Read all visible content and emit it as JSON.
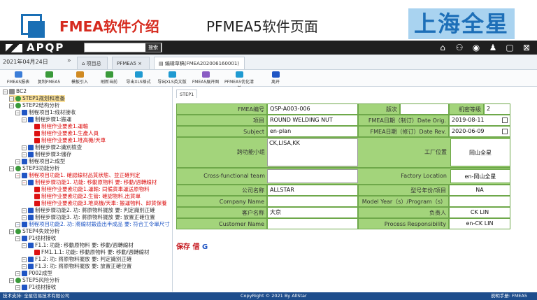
{
  "slide": {
    "title_red": "FMEA软件介绍",
    "title_black": "PFMEA5软件页面",
    "brand": "上海全星"
  },
  "navbar": {
    "app_name": "APQP",
    "search_button": "搜索"
  },
  "tabbar": {
    "date": "2021年04月24日",
    "tabs": [
      "项目总览",
      "PFMEA5",
      "编辑草稿(FMEA202006160001)"
    ]
  },
  "toolbar": {
    "items": [
      "FMEAS报表",
      "复制FMEA5",
      "模板引入",
      "刷新当前",
      "导出XLS格式",
      "导出XLS英文版",
      "FMEA5展开图",
      "PFMEA5优化清单",
      "离开"
    ]
  },
  "tree": {
    "nodes": [
      {
        "text": "BC2",
        "level": 0,
        "style": ""
      },
      {
        "text": "STEP1规划和准备",
        "level": 1,
        "style": "sel"
      },
      {
        "text": "STEP2结构分析",
        "level": 1,
        "style": ""
      },
      {
        "text": "制程项目1:线材接收",
        "level": 2,
        "style": ""
      },
      {
        "text": "制程步骤1:搬運",
        "level": 3,
        "style": ""
      },
      {
        "text": "制程作业要素1.運輸",
        "level": 4,
        "style": "red"
      },
      {
        "text": "制程作业要素1.生產人員",
        "level": 4,
        "style": "red"
      },
      {
        "text": "制程作业要素1.堆高機/天車",
        "level": 4,
        "style": "red"
      },
      {
        "text": "制程步骤2:識別檢查",
        "level": 3,
        "style": ""
      },
      {
        "text": "制程步骤3:儲存",
        "level": 3,
        "style": ""
      },
      {
        "text": "制程项目2:成型",
        "level": 2,
        "style": ""
      },
      {
        "text": "STEP3功能分析",
        "level": 1,
        "style": ""
      },
      {
        "text": "制程项目功能1. 確認線材品質狀態、並正確判定",
        "level": 2,
        "style": "red"
      },
      {
        "text": "制程步骤功能1. 功能: 移動原物料 要: 移動/週轉線材",
        "level": 3,
        "style": "red"
      },
      {
        "text": "制程作业要素功能1.運輸: 同備貨車運送原物料",
        "level": 4,
        "style": "red"
      },
      {
        "text": "制程作业要素功能2.生管: 確認物料,出貨單",
        "level": 4,
        "style": "red"
      },
      {
        "text": "制程作业要素功能3.堆高機/天車: 搬運物料、卸貨保養",
        "level": 4,
        "style": "red"
      },
      {
        "text": "制程步骤功能2. 功: 將原物料擺放 要: 判定識別正確",
        "level": 3,
        "style": ""
      },
      {
        "text": "制程步骤功能3. 功: 將原物料擺放 要: 放置正確位置",
        "level": 3,
        "style": ""
      },
      {
        "text": "制程项目功能2. 功: 將線材鍛造出半成品 要: 符合工令單尺寸",
        "level": 2,
        "style": "blue"
      },
      {
        "text": "STEP4失效分析",
        "level": 1,
        "style": ""
      },
      {
        "text": "P1线材接收",
        "level": 2,
        "style": ""
      },
      {
        "text": "F1.1: 功能: 移動原物料 要: 移動/週轉線材",
        "level": 3,
        "style": ""
      },
      {
        "text": "FM1.1.1: 功能: 移動原物料 要: 移動/週轉線材",
        "level": 4,
        "style": ""
      },
      {
        "text": "F1.2: 功: 將原物料擺放 要: 判定識別正確",
        "level": 3,
        "style": ""
      },
      {
        "text": "F1.3: 功: 將原物料擺放 要: 放置正確位置",
        "level": 3,
        "style": ""
      },
      {
        "text": "P002成型",
        "level": 2,
        "style": ""
      },
      {
        "text": "STEP5风险分析",
        "level": 1,
        "style": ""
      },
      {
        "text": "P1线材接收",
        "level": 2,
        "style": ""
      }
    ]
  },
  "panel": {
    "step_tab": "STEP1",
    "labels": {
      "fmea_no": "FMEA编号",
      "version": "版次",
      "secrecy": "机密等级",
      "item": "项目",
      "orig_date": "FMEA日期（制订）Date Orig.",
      "subject": "Subject",
      "rev_date": "FMEA日期（修订）Date Rev.",
      "cross_team_cn": "跨功能小组",
      "factory_cn": "工厂位置",
      "cross_team_en": "Cross-functional team",
      "factory_en": "Factory Location",
      "company_cn": "公司名称",
      "model_cn": "型号年份/项目",
      "company_en": "Company Name",
      "model_en": "Model Year（s）/Program（s）",
      "customer_cn": "客户名称",
      "owner_cn": "负责人",
      "customer_en": "Customer Name",
      "owner_en": "Process Responsibility"
    },
    "values": {
      "fmea_no": "QSP-A003-006",
      "version": "",
      "secrecy": "2",
      "item": "ROUND WELDING NUT",
      "orig_date": "2019-08-11",
      "subject": "en-plan",
      "rev_date": "2020-06-09",
      "cross_team": "CK,LISA,KK",
      "factory_cn": "岡山全星",
      "factory_en": "en-岡山全星",
      "company": "ALLSTAR",
      "model": "NA",
      "customer": "大京",
      "owner_cn": "CK LIN",
      "owner_en": "en-CK LIN"
    },
    "save_label": "保存",
    "save_shortcut": "借",
    "save_suffix": "G"
  },
  "footer": {
    "left": "技术支持: 全星信易技术有限公司",
    "center": "CopyRight © 2021 By AllStar",
    "right": "说明手册: FMEA5"
  }
}
